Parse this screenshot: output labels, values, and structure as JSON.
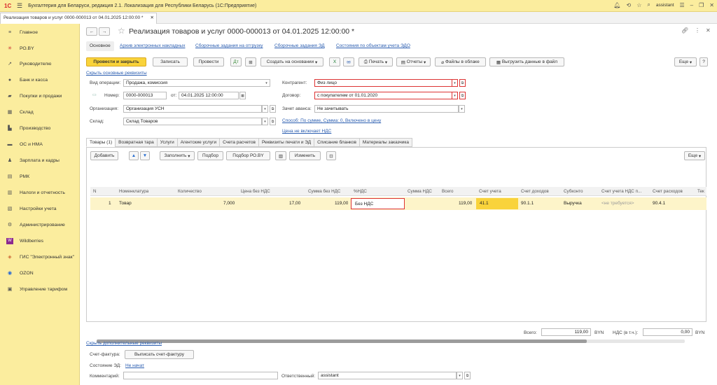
{
  "window": {
    "logo": "1С",
    "title": "Бухгалтерия для Беларуси, редакция 2.1. Локализация для Республики Беларусь   (1С:Предприятие)",
    "user": "assistant"
  },
  "open_tab": {
    "label": "Реализация товаров и услуг 0000-000013 от 04.01.2025 12:00:00 *"
  },
  "sidebar": {
    "items": [
      {
        "label": "Главное",
        "icon": "menu-icon"
      },
      {
        "label": "РО.BY",
        "icon": "asterisk-icon"
      },
      {
        "label": "Руководителю",
        "icon": "trend-icon"
      },
      {
        "label": "Банк и касса",
        "icon": "bank-icon"
      },
      {
        "label": "Покупки и продажи",
        "icon": "cart-icon"
      },
      {
        "label": "Склад",
        "icon": "warehouse-icon"
      },
      {
        "label": "Производство",
        "icon": "factory-icon"
      },
      {
        "label": "ОС и НМА",
        "icon": "truck-icon"
      },
      {
        "label": "Зарплата и кадры",
        "icon": "people-icon"
      },
      {
        "label": "РМК",
        "icon": "register-icon"
      },
      {
        "label": "Налоги и отчетность",
        "icon": "report-icon"
      },
      {
        "label": "Настройки учета",
        "icon": "settings-doc-icon"
      },
      {
        "label": "Администрирование",
        "icon": "gear-icon"
      },
      {
        "label": "Wildberries",
        "icon": "wildberries-icon"
      },
      {
        "label": "ГИС \"Электронный знак\"",
        "icon": "diamond-icon"
      },
      {
        "label": "OZON",
        "icon": "ozon-icon"
      },
      {
        "label": "Управление тарифом",
        "icon": "tariff-icon"
      }
    ]
  },
  "doc": {
    "title": "Реализация товаров и услуг 0000-000013 от 04.01.2025 12:00:00 *",
    "subnav": [
      "Основное",
      "Архив электронных накладных",
      "Сборочные задания на отгрузку",
      "Сборочные задания ЭД",
      "Состояния по объектам учета ЭДО"
    ],
    "toolbar": {
      "post_close": "Провести и закрыть",
      "save": "Записать",
      "post": "Провести",
      "create_based": "Создать на основании",
      "print": "Печать",
      "reports": "Отчеты",
      "cloud_files": "Файлы в облаке",
      "export_file": "Выгрузить данные в файл",
      "more": "Еще"
    },
    "hide_main_attrs": "Скрыть основные реквизиты",
    "fields": {
      "operation_label": "Вид операции:",
      "operation_value": "Продажа, комиссия",
      "number_label": "Номер:",
      "number_value": "0000-000013",
      "date_label": "от:",
      "date_value": "04.01.2025 12:00:00",
      "org_label": "Организация:",
      "org_value": "Организация УСН",
      "warehouse_label": "Склад:",
      "warehouse_value": "Склад Товаров",
      "counterparty_label": "Контрагент:",
      "counterparty_value": "Физ лицо",
      "contract_label": "Договор:",
      "contract_value": "с покупателем от 01.01.2020",
      "advance_label": "Зачет аванса:",
      "advance_value": "Не зачитывать",
      "vat_method_link": "Способ: По сумме, Сумма: 0, Включено в цену",
      "price_vat_link": "Цена не включает НДС"
    },
    "tabs": [
      "Товары (1)",
      "Возвратная тара",
      "Услуги",
      "Агентские услуги",
      "Счета расчетов",
      "Реквизиты печати и ЭД",
      "Списание бланков",
      "Материалы заказчика"
    ],
    "table_toolbar": {
      "add": "Добавить",
      "fill": "Заполнить",
      "selection": "Подбор",
      "selection_ro": "Подбор РО.BY",
      "change": "Изменить",
      "more": "Еще"
    },
    "columns": [
      "N",
      "Номенклатура",
      "Количество",
      "Цена без НДС",
      "Сумма без НДС",
      "%НДС",
      "Сумма НДС",
      "Всего",
      "Счет учета",
      "Счет доходов",
      "Субконто",
      "Счет учета НДС п...",
      "Счет расходов",
      "Тек"
    ],
    "rows": [
      {
        "n": "1",
        "item": "Товар",
        "qty": "7,000",
        "price": "17,00",
        "sum": "119,00",
        "vat_rate": "Без НДС",
        "vat_sum": "",
        "total": "119,00",
        "account": "41.1",
        "income_account": "90.1.1",
        "subconto": "Выручка",
        "vat_account": "<не требуется>",
        "expense_account": "90.4.1"
      }
    ],
    "totals": {
      "total_label": "Всего:",
      "total_value": "119,00",
      "currency": "BYN",
      "vat_label": "НДС (в т.ч.):",
      "vat_value": "0,00",
      "vat_currency": "BYN"
    },
    "hide_extra_attrs": "Скрыть дополнительные реквизиты",
    "invoice_label": "Счет-фактура:",
    "invoice_button": "Выписать счет-фактуру",
    "ed_state_label": "Состояние ЭД:",
    "ed_state_value": "Не начат",
    "comment_label": "Комментарий:",
    "comment_value": "",
    "responsible_label": "Ответственный:",
    "responsible_value": "assistant"
  }
}
